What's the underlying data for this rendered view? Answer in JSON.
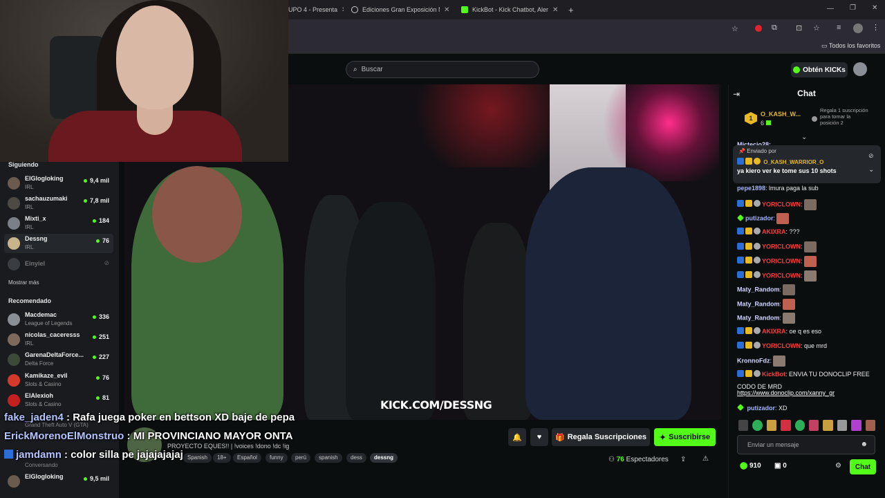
{
  "browser": {
    "tabs": [
      {
        "title": "UPO 4 - Presenta"
      },
      {
        "title": "Ediciones Gran Exposición Mun"
      },
      {
        "title": "KickBot - Kick Chatbot, Alerts, T"
      }
    ],
    "new_tab": "+",
    "bookmarks_label": "Todos los favoritos"
  },
  "header": {
    "search_placeholder": "Buscar",
    "get_kicks_label": "Obtén KICKs"
  },
  "sidebar": {
    "following_title": "Siguiendo",
    "following": [
      {
        "name": "ElGlogloking",
        "category": "IRL",
        "viewers": "9,4 mil",
        "avatar_color": "#6b5a4e"
      },
      {
        "name": "sachauzumaki",
        "category": "IRL",
        "viewers": "7,8 mil",
        "avatar_color": "#4d4a45"
      },
      {
        "name": "Mixti_x",
        "category": "IRL",
        "viewers": "184",
        "avatar_color": "#7a7f88"
      },
      {
        "name": "Dessng",
        "category": "IRL",
        "viewers": "76",
        "avatar_color": "#c9b48a"
      }
    ],
    "offline": {
      "name": "Einyiel"
    },
    "show_more": "Mostrar más",
    "recommended_title": "Recomendado",
    "recommended": [
      {
        "name": "Macdemac",
        "category": "League of Legends",
        "viewers": "336",
        "avatar_color": "#8a8f96"
      },
      {
        "name": "nicolas_caceresss",
        "category": "IRL",
        "viewers": "251",
        "avatar_color": "#7d6a5c"
      },
      {
        "name": "GarenaDeltaForce...",
        "category": "Delta Force",
        "viewers": "227",
        "avatar_color": "#3d4a3a"
      },
      {
        "name": "Kamikaze_evil",
        "category": "Slots & Casino",
        "viewers": "76",
        "avatar_color": "#d33a2c"
      },
      {
        "name": "ElAlexioh",
        "category": "Slots & Casino",
        "viewers": "81",
        "avatar_color": "#c42020"
      }
    ],
    "partial_category": "Grand Theft Auto V (GTA)",
    "partial_sub": "Conversando",
    "bottom_item": {
      "name": "ElGlogloking",
      "viewers": "9,5 mil"
    }
  },
  "overlay_chat": [
    {
      "user": "fake_jaden4",
      "text": " : Rafa juega poker en bettson XD baje de pepa"
    },
    {
      "user": "ErickMorenoElMonstruo",
      "text": " : MI PROVINCIANO MAYOR ONTA"
    },
    {
      "user": "jamdamn",
      "text": " : color silla pe jajajajajaj"
    }
  ],
  "video": {
    "watermark": "KICK.COM/DESSNG"
  },
  "stream_info": {
    "title": "PROYECTO EQUES!! | !voices !dono !dc !ig",
    "tags": [
      "Spanish",
      "18+",
      "Español",
      "funny",
      "perú",
      "spanish",
      "dess",
      "dessng"
    ],
    "gift_subs_label": "Regala Suscripciones",
    "subscribe_label": "Suscribirse",
    "viewers": "76",
    "viewers_label": "Espectadores"
  },
  "chat": {
    "title": "Chat",
    "leaderboard": {
      "rank": "1",
      "user": "O_KASH_W...",
      "count": "6",
      "gift_text": "Regala 1 suscripción para tomar la posición 2"
    },
    "cut_user": "Mictecio28:",
    "pinned": {
      "label": "Enviado por",
      "user": "O_KASH_WARRIOR_O",
      "message": "ya kiero ver ke tome sus 10 shots"
    },
    "messages": [
      {
        "user": "pepe1898",
        "text": ": lmura paga la sub",
        "color": "#a5b4fc",
        "emote": false
      },
      {
        "user": "YORICLOWN",
        "text": ":",
        "color": "#ff3b3b",
        "emote": true
      },
      {
        "user": "putizador",
        "text": ":",
        "color": "#a5b4fc",
        "emote": true
      },
      {
        "user": "AKIXRA",
        "text": ": ???",
        "color": "#ff3b3b",
        "emote": false
      },
      {
        "user": "YORICLOWN",
        "text": ":",
        "color": "#ff3b3b",
        "emote": true
      },
      {
        "user": "YORICLOWN",
        "text": ":",
        "color": "#ff3b3b",
        "emote": true
      },
      {
        "user": "YORICLOWN",
        "text": ":",
        "color": "#ff3b3b",
        "emote": true
      },
      {
        "user": "Maty_Random",
        "text": ":",
        "color": "#d0d4ff",
        "emote": true
      },
      {
        "user": "Maty_Random",
        "text": ":",
        "color": "#d0d4ff",
        "emote": true
      },
      {
        "user": "Maty_Random",
        "text": ":",
        "color": "#d0d4ff",
        "emote": true
      },
      {
        "user": "AKIXRA",
        "text": ": oe q es eso",
        "color": "#ff3b3b",
        "emote": false
      },
      {
        "user": "YORICLOWN",
        "text": ": que mrd",
        "color": "#ff3b3b",
        "emote": false
      },
      {
        "user": "KronnoFdz",
        "text": ":",
        "color": "#d0d4ff",
        "emote": true
      },
      {
        "user": "KickBot",
        "text": ": ENVIA TU DONOCLIP FREE",
        "color": "#ff3b3b",
        "emote": false
      }
    ],
    "kickbot_line2": "CODO DE MRD",
    "kickbot_link": "https://www.donoclip.com/xanny_gr",
    "last_message": {
      "user": "putizador",
      "text": ": XD"
    },
    "input_placeholder": "Enviar un mensaje",
    "kicks": "910",
    "points": "0",
    "send_label": "Chat"
  },
  "colors": {
    "kick_green": "#53fc18",
    "bg": "#0b0e0f",
    "panel": "#191b1f"
  }
}
